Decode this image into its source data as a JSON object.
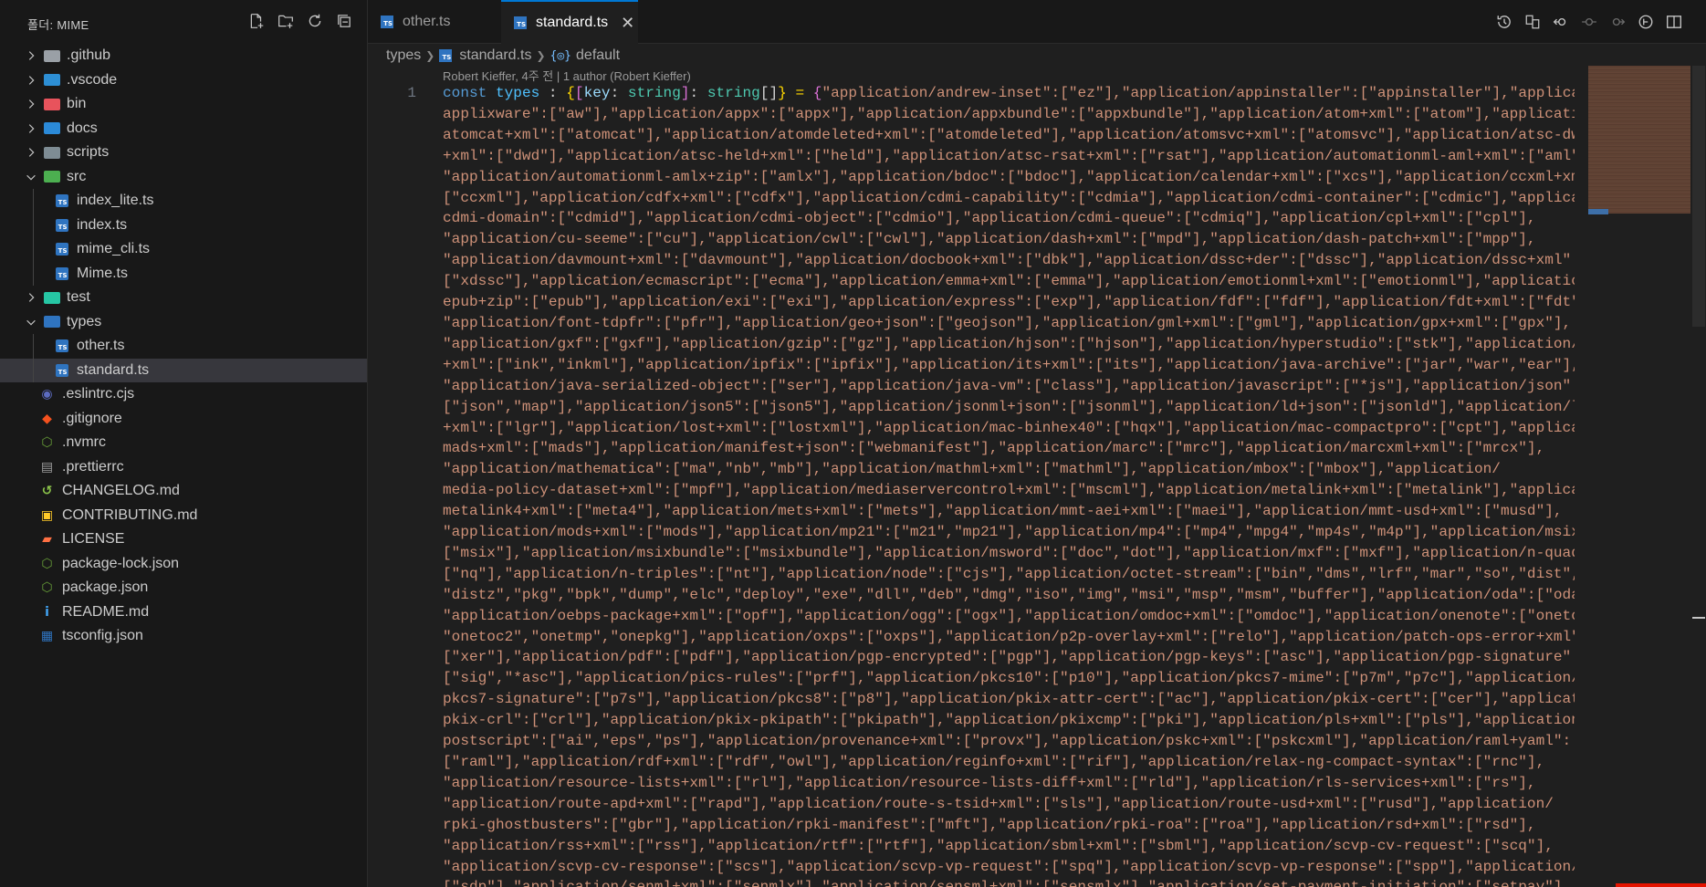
{
  "sidebar": {
    "title": "폴더: MIME",
    "actions": [
      {
        "name": "new-file-icon"
      },
      {
        "name": "new-folder-icon"
      },
      {
        "name": "refresh-icon"
      },
      {
        "name": "collapse-all-icon"
      }
    ],
    "items": [
      {
        "label": ".github",
        "type": "folder",
        "expanded": false,
        "depth": 0,
        "color": "#9aa0a6",
        "icon": "github-folder-icon"
      },
      {
        "label": ".vscode",
        "type": "folder",
        "expanded": false,
        "depth": 0,
        "color": "#2d8fd5",
        "icon": "vscode-folder-icon"
      },
      {
        "label": "bin",
        "type": "folder",
        "expanded": false,
        "depth": 0,
        "color": "#e8535c",
        "icon": "bin-folder-icon"
      },
      {
        "label": "docs",
        "type": "folder",
        "expanded": false,
        "depth": 0,
        "color": "#2b8ad8",
        "icon": "docs-folder-icon"
      },
      {
        "label": "scripts",
        "type": "folder",
        "expanded": false,
        "depth": 0,
        "color": "#7e8c94",
        "icon": "scripts-folder-icon"
      },
      {
        "label": "src",
        "type": "folder",
        "expanded": true,
        "depth": 0,
        "color": "#4caf50",
        "icon": "src-folder-icon"
      },
      {
        "label": "index_lite.ts",
        "type": "ts",
        "depth": 1,
        "icon": "typescript-file-icon"
      },
      {
        "label": "index.ts",
        "type": "ts",
        "depth": 1,
        "icon": "typescript-file-icon"
      },
      {
        "label": "mime_cli.ts",
        "type": "ts",
        "depth": 1,
        "icon": "typescript-file-icon"
      },
      {
        "label": "Mime.ts",
        "type": "ts",
        "depth": 1,
        "icon": "typescript-file-icon"
      },
      {
        "label": "test",
        "type": "folder",
        "expanded": false,
        "depth": 0,
        "color": "#26c6a4",
        "icon": "test-folder-icon"
      },
      {
        "label": "types",
        "type": "folder",
        "expanded": true,
        "depth": 0,
        "color": "#2f74c0",
        "icon": "types-folder-icon"
      },
      {
        "label": "other.ts",
        "type": "ts",
        "depth": 1,
        "icon": "typescript-file-icon"
      },
      {
        "label": "standard.ts",
        "type": "ts",
        "depth": 1,
        "selected": true,
        "icon": "typescript-file-icon"
      },
      {
        "label": ".eslintrc.cjs",
        "type": "file",
        "depth": 0,
        "color": "#5c6bc0",
        "glyph": "◉",
        "icon": "eslint-file-icon"
      },
      {
        "label": ".gitignore",
        "type": "file",
        "depth": 0,
        "color": "#f4511e",
        "glyph": "◆",
        "icon": "git-file-icon"
      },
      {
        "label": ".nvmrc",
        "type": "file",
        "depth": 0,
        "color": "#689f38",
        "glyph": "⬡",
        "icon": "nodejs-file-icon"
      },
      {
        "label": ".prettierrc",
        "type": "file",
        "depth": 0,
        "color": "#9e9e9e",
        "glyph": "▤",
        "icon": "prettier-file-icon"
      },
      {
        "label": "CHANGELOG.md",
        "type": "file",
        "depth": 0,
        "color": "#8bc34a",
        "glyph": "↺",
        "icon": "changelog-file-icon"
      },
      {
        "label": "CONTRIBUTING.md",
        "type": "file",
        "depth": 0,
        "color": "#ffca28",
        "glyph": "▣",
        "icon": "contributing-file-icon"
      },
      {
        "label": "LICENSE",
        "type": "file",
        "depth": 0,
        "color": "#ff7043",
        "glyph": "▰",
        "icon": "license-file-icon"
      },
      {
        "label": "package-lock.json",
        "type": "file",
        "depth": 0,
        "color": "#689f38",
        "glyph": "⬡",
        "icon": "npm-file-icon"
      },
      {
        "label": "package.json",
        "type": "file",
        "depth": 0,
        "color": "#689f38",
        "glyph": "⬡",
        "icon": "npm-file-icon"
      },
      {
        "label": "README.md",
        "type": "file",
        "depth": 0,
        "color": "#42a5f5",
        "glyph": "i",
        "icon": "readme-file-icon"
      },
      {
        "label": "tsconfig.json",
        "type": "file",
        "depth": 0,
        "color": "#2f74c0",
        "glyph": "▦",
        "icon": "tsconfig-file-icon"
      }
    ]
  },
  "tabs": [
    {
      "label": "other.ts",
      "active": false
    },
    {
      "label": "standard.ts",
      "active": true
    }
  ],
  "tab_close_glyph": "✕",
  "editor_actions": [
    {
      "name": "timeline-icon"
    },
    {
      "name": "compare-changes-icon"
    },
    {
      "name": "go-back-icon"
    },
    {
      "name": "revert-icon"
    },
    {
      "name": "go-forward-icon"
    },
    {
      "name": "copilot-icon"
    },
    {
      "name": "split-editor-icon"
    }
  ],
  "breadcrumb": {
    "folder": "types",
    "file": "standard.ts",
    "symbol": "default",
    "symbol_glyph": "{◎}"
  },
  "codelens": "Robert Kieffer, 4주 전 | 1 author (Robert Kieffer)",
  "line_number": "1",
  "code_prefix": {
    "const": "const",
    "name": "types",
    "colon": " : ",
    "brace_open": "{",
    "bracket": "[",
    "key": "key",
    "sep1": ": ",
    "type1": "string",
    "bracket_close": "]",
    "sep2": ": ",
    "type2": "string",
    "arr": "[]",
    "sep3": "} = ",
    "obj_open": "{"
  },
  "code_lines": [
    "\"application/andrew-inset\":[\"ez\"],\"application/appinstaller\":[\"appinstaller\"],\"application/",
    "applixware\":[\"aw\"],\"application/appx\":[\"appx\"],\"application/appxbundle\":[\"appxbundle\"],\"application/atom+xml\":[\"atom\"],\"application/",
    "atomcat+xml\":[\"atomcat\"],\"application/atomdeleted+xml\":[\"atomdeleted\"],\"application/atomsvc+xml\":[\"atomsvc\"],\"application/atsc-dwd",
    "+xml\":[\"dwd\"],\"application/atsc-held+xml\":[\"held\"],\"application/atsc-rsat+xml\":[\"rsat\"],\"application/automationml-aml+xml\":[\"aml\"],",
    "\"application/automationml-amlx+zip\":[\"amlx\"],\"application/bdoc\":[\"bdoc\"],\"application/calendar+xml\":[\"xcs\"],\"application/ccxml+xml\":",
    "[\"ccxml\"],\"application/cdfx+xml\":[\"cdfx\"],\"application/cdmi-capability\":[\"cdmia\"],\"application/cdmi-container\":[\"cdmic\"],\"application/",
    "cdmi-domain\":[\"cdmid\"],\"application/cdmi-object\":[\"cdmio\"],\"application/cdmi-queue\":[\"cdmiq\"],\"application/cpl+xml\":[\"cpl\"],",
    "\"application/cu-seeme\":[\"cu\"],\"application/cwl\":[\"cwl\"],\"application/dash+xml\":[\"mpd\"],\"application/dash-patch+xml\":[\"mpp\"],",
    "\"application/davmount+xml\":[\"davmount\"],\"application/docbook+xml\":[\"dbk\"],\"application/dssc+der\":[\"dssc\"],\"application/dssc+xml\":",
    "[\"xdssc\"],\"application/ecmascript\":[\"ecma\"],\"application/emma+xml\":[\"emma\"],\"application/emotionml+xml\":[\"emotionml\"],\"application/",
    "epub+zip\":[\"epub\"],\"application/exi\":[\"exi\"],\"application/express\":[\"exp\"],\"application/fdf\":[\"fdf\"],\"application/fdt+xml\":[\"fdt\"],",
    "\"application/font-tdpfr\":[\"pfr\"],\"application/geo+json\":[\"geojson\"],\"application/gml+xml\":[\"gml\"],\"application/gpx+xml\":[\"gpx\"],",
    "\"application/gxf\":[\"gxf\"],\"application/gzip\":[\"gz\"],\"application/hjson\":[\"hjson\"],\"application/hyperstudio\":[\"stk\"],\"application/inkml",
    "+xml\":[\"ink\",\"inkml\"],\"application/ipfix\":[\"ipfix\"],\"application/its+xml\":[\"its\"],\"application/java-archive\":[\"jar\",\"war\",\"ear\"],",
    "\"application/java-serialized-object\":[\"ser\"],\"application/java-vm\":[\"class\"],\"application/javascript\":[\"*js\"],\"application/json\":",
    "[\"json\",\"map\"],\"application/json5\":[\"json5\"],\"application/jsonml+json\":[\"jsonml\"],\"application/ld+json\":[\"jsonld\"],\"application/lgr",
    "+xml\":[\"lgr\"],\"application/lost+xml\":[\"lostxml\"],\"application/mac-binhex40\":[\"hqx\"],\"application/mac-compactpro\":[\"cpt\"],\"application/",
    "mads+xml\":[\"mads\"],\"application/manifest+json\":[\"webmanifest\"],\"application/marc\":[\"mrc\"],\"application/marcxml+xml\":[\"mrcx\"],",
    "\"application/mathematica\":[\"ma\",\"nb\",\"mb\"],\"application/mathml+xml\":[\"mathml\"],\"application/mbox\":[\"mbox\"],\"application/",
    "media-policy-dataset+xml\":[\"mpf\"],\"application/mediaservercontrol+xml\":[\"mscml\"],\"application/metalink+xml\":[\"metalink\"],\"application/",
    "metalink4+xml\":[\"meta4\"],\"application/mets+xml\":[\"mets\"],\"application/mmt-aei+xml\":[\"maei\"],\"application/mmt-usd+xml\":[\"musd\"],",
    "\"application/mods+xml\":[\"mods\"],\"application/mp21\":[\"m21\",\"mp21\"],\"application/mp4\":[\"mp4\",\"mpg4\",\"mp4s\",\"m4p\"],\"application/msix\":",
    "[\"msix\"],\"application/msixbundle\":[\"msixbundle\"],\"application/msword\":[\"doc\",\"dot\"],\"application/mxf\":[\"mxf\"],\"application/n-quads\":",
    "[\"nq\"],\"application/n-triples\":[\"nt\"],\"application/node\":[\"cjs\"],\"application/octet-stream\":[\"bin\",\"dms\",\"lrf\",\"mar\",\"so\",\"dist\",",
    "\"distz\",\"pkg\",\"bpk\",\"dump\",\"elc\",\"deploy\",\"exe\",\"dll\",\"deb\",\"dmg\",\"iso\",\"img\",\"msi\",\"msp\",\"msm\",\"buffer\"],\"application/oda\":[\"oda\"],",
    "\"application/oebps-package+xml\":[\"opf\"],\"application/ogg\":[\"ogx\"],\"application/omdoc+xml\":[\"omdoc\"],\"application/onenote\":[\"onetoc\",",
    "\"onetoc2\",\"onetmp\",\"onepkg\"],\"application/oxps\":[\"oxps\"],\"application/p2p-overlay+xml\":[\"relo\"],\"application/patch-ops-error+xml\":",
    "[\"xer\"],\"application/pdf\":[\"pdf\"],\"application/pgp-encrypted\":[\"pgp\"],\"application/pgp-keys\":[\"asc\"],\"application/pgp-signature\":",
    "[\"sig\",\"*asc\"],\"application/pics-rules\":[\"prf\"],\"application/pkcs10\":[\"p10\"],\"application/pkcs7-mime\":[\"p7m\",\"p7c\"],\"application/",
    "pkcs7-signature\":[\"p7s\"],\"application/pkcs8\":[\"p8\"],\"application/pkix-attr-cert\":[\"ac\"],\"application/pkix-cert\":[\"cer\"],\"application/",
    "pkix-crl\":[\"crl\"],\"application/pkix-pkipath\":[\"pkipath\"],\"application/pkixcmp\":[\"pki\"],\"application/pls+xml\":[\"pls\"],\"application/",
    "postscript\":[\"ai\",\"eps\",\"ps\"],\"application/provenance+xml\":[\"provx\"],\"application/pskc+xml\":[\"pskcxml\"],\"application/raml+yaml\":",
    "[\"raml\"],\"application/rdf+xml\":[\"rdf\",\"owl\"],\"application/reginfo+xml\":[\"rif\"],\"application/relax-ng-compact-syntax\":[\"rnc\"],",
    "\"application/resource-lists+xml\":[\"rl\"],\"application/resource-lists-diff+xml\":[\"rld\"],\"application/rls-services+xml\":[\"rs\"],",
    "\"application/route-apd+xml\":[\"rapd\"],\"application/route-s-tsid+xml\":[\"sls\"],\"application/route-usd+xml\":[\"rusd\"],\"application/",
    "rpki-ghostbusters\":[\"gbr\"],\"application/rpki-manifest\":[\"mft\"],\"application/rpki-roa\":[\"roa\"],\"application/rsd+xml\":[\"rsd\"],",
    "\"application/rss+xml\":[\"rss\"],\"application/rtf\":[\"rtf\"],\"application/sbml+xml\":[\"sbml\"],\"application/scvp-cv-request\":[\"scq\"],",
    "\"application/scvp-cv-response\":[\"scs\"],\"application/scvp-vp-request\":[\"spq\"],\"application/scvp-vp-response\":[\"spp\"],\"application/sdp\":",
    "[\"sdp\"],\"application/senml+xml\":[\"senmlx\"],\"application/sensml+xml\":[\"sensmlx\"],\"application/set-payment-initiation\":[\"setpay\"],"
  ],
  "colors": {
    "accent": "#0078d4",
    "string": "#ce9178",
    "keyword": "#569cd6",
    "type": "#4ec9b0",
    "typescript": "#2f74c0",
    "selection": "#37373d"
  }
}
